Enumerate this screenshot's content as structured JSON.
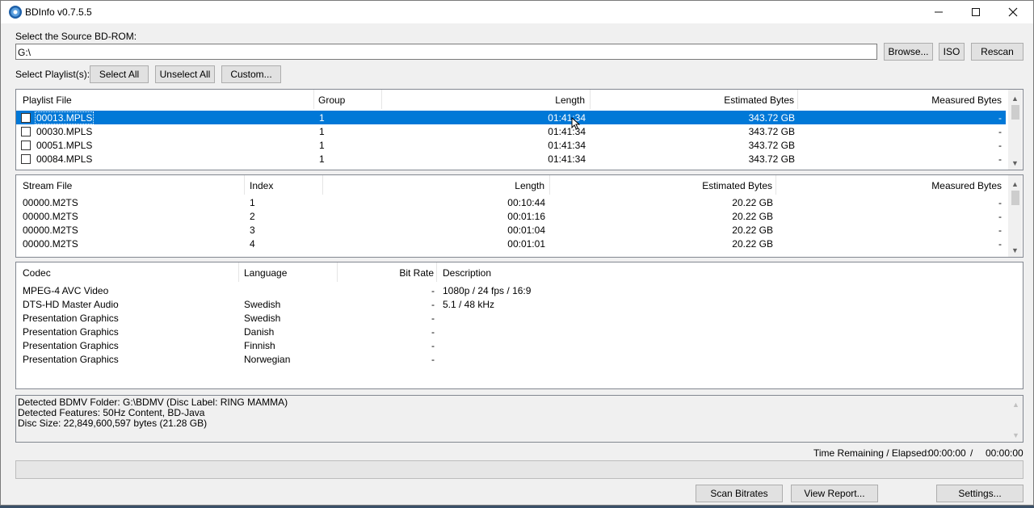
{
  "window": {
    "title": "BDInfo v0.7.5.5"
  },
  "source": {
    "label": "Select the Source BD-ROM:",
    "path": "G:\\",
    "browse_label": "Browse...",
    "iso_label": "ISO",
    "rescan_label": "Rescan"
  },
  "playlist_controls": {
    "label": "Select Playlist(s):",
    "select_all": "Select All",
    "unselect_all": "Unselect All",
    "custom": "Custom..."
  },
  "playlists": {
    "headers": [
      "Playlist File",
      "Group",
      "Length",
      "Estimated Bytes",
      "Measured Bytes"
    ],
    "rows": [
      {
        "file": "00013.MPLS",
        "group": "1",
        "length": "01:41:34",
        "est": "343.72 GB",
        "meas": "-"
      },
      {
        "file": "00030.MPLS",
        "group": "1",
        "length": "01:41:34",
        "est": "343.72 GB",
        "meas": "-"
      },
      {
        "file": "00051.MPLS",
        "group": "1",
        "length": "01:41:34",
        "est": "343.72 GB",
        "meas": "-"
      },
      {
        "file": "00084.MPLS",
        "group": "1",
        "length": "01:41:34",
        "est": "343.72 GB",
        "meas": "-"
      }
    ]
  },
  "streams": {
    "headers": [
      "Stream File",
      "Index",
      "Length",
      "Estimated Bytes",
      "Measured Bytes"
    ],
    "rows": [
      {
        "file": "00000.M2TS",
        "index": "1",
        "length": "00:10:44",
        "est": "20.22 GB",
        "meas": "-"
      },
      {
        "file": "00000.M2TS",
        "index": "2",
        "length": "00:01:16",
        "est": "20.22 GB",
        "meas": "-"
      },
      {
        "file": "00000.M2TS",
        "index": "3",
        "length": "00:01:04",
        "est": "20.22 GB",
        "meas": "-"
      },
      {
        "file": "00000.M2TS",
        "index": "4",
        "length": "00:01:01",
        "est": "20.22 GB",
        "meas": "-"
      }
    ]
  },
  "codecs": {
    "headers": [
      "Codec",
      "Language",
      "Bit Rate",
      "Description"
    ],
    "rows": [
      {
        "codec": "MPEG-4 AVC Video",
        "lang": "",
        "bitrate": "-",
        "desc": "1080p / 24 fps / 16:9"
      },
      {
        "codec": "DTS-HD Master Audio",
        "lang": "Swedish",
        "bitrate": "-",
        "desc": "5.1 / 48 kHz"
      },
      {
        "codec": "Presentation Graphics",
        "lang": "Swedish",
        "bitrate": "-",
        "desc": ""
      },
      {
        "codec": "Presentation Graphics",
        "lang": "Danish",
        "bitrate": "-",
        "desc": ""
      },
      {
        "codec": "Presentation Graphics",
        "lang": "Finnish",
        "bitrate": "-",
        "desc": ""
      },
      {
        "codec": "Presentation Graphics",
        "lang": "Norwegian",
        "bitrate": "-",
        "desc": ""
      }
    ]
  },
  "info": {
    "line1": "Detected BDMV Folder: G:\\BDMV (Disc Label: RING MAMMA)",
    "line2": "Detected Features: 50Hz Content, BD-Java",
    "line3": "Disc Size: 22,849,600,597 bytes (21.28 GB)"
  },
  "time": {
    "label": "Time Remaining / Elapsed:",
    "remaining": "00:00:00",
    "separator": "/",
    "elapsed": "00:00:00"
  },
  "progress": {
    "fraction": 0
  },
  "footer": {
    "scan_bitrates": "Scan Bitrates",
    "view_report": "View Report...",
    "settings": "Settings..."
  }
}
